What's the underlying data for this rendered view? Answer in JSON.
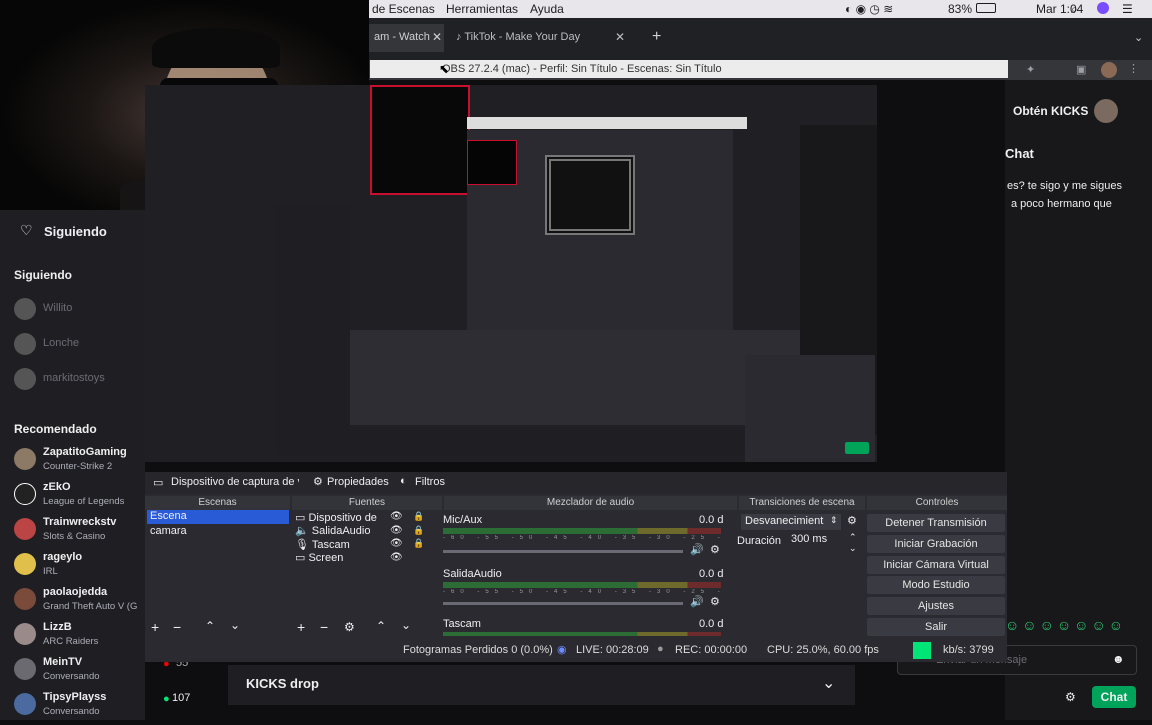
{
  "menubar": {
    "items": [
      "de Escenas",
      "Herramientas",
      "Ayuda"
    ],
    "battery": "83%",
    "time": "Mar 1:04"
  },
  "chrome": {
    "tabs": [
      {
        "label": "am - Watch"
      },
      {
        "label": "TikTok - Make Your Day"
      }
    ]
  },
  "obs_window": {
    "title": "OBS 27.2.4 (mac) - Perfil: Sin Título - Escenas: Sin Título"
  },
  "twitch": {
    "nav": {
      "following_heading": "Siguiendo",
      "following_label": "Siguiendo",
      "recommended_label": "Recomendado"
    },
    "following": [
      {
        "name": "Willito"
      },
      {
        "name": "Lonche"
      },
      {
        "name": "markitostoys"
      }
    ],
    "recommended": [
      {
        "name": "ZapatitoGaming",
        "game": "Counter-Strike 2"
      },
      {
        "name": "zEkO",
        "game": "League of Legends"
      },
      {
        "name": "Trainwreckstv",
        "game": "Slots & Casino"
      },
      {
        "name": "rageylo",
        "game": "IRL"
      },
      {
        "name": "paolaojedda",
        "game": "Grand Theft Auto V (G"
      },
      {
        "name": "LizzB",
        "game": "ARC Raiders"
      },
      {
        "name": "MeinTV",
        "game": "Conversando",
        "viewers": "55"
      },
      {
        "name": "TipsyPlayss",
        "game": "Conversando",
        "viewers": "107"
      }
    ],
    "right": {
      "kicks_button": "Obtén KICKS",
      "chat_heading": "Chat",
      "chat_line1": "es? te sigo y me sigues",
      "chat_line2": "a poco hermano que",
      "chat_input_placeholder": "Enviar un mensaje",
      "chat_button": "Chat"
    },
    "kicks_drop": "KICKS drop"
  },
  "obs": {
    "toolbar": {
      "source": "Dispositivo de captura de v",
      "properties": "Propiedades",
      "filters": "Filtros"
    },
    "docks": {
      "scenes": "Escenas",
      "sources": "Fuentes",
      "mixer": "Mezclador de audio",
      "transitions": "Transiciones de escena",
      "controls": "Controles"
    },
    "scenes": [
      "Escena",
      "camara"
    ],
    "sources": [
      "Dispositivo de",
      "SalidaAudio",
      "Tascam",
      "Screen"
    ],
    "mixer": [
      {
        "name": "Mic/Aux",
        "level": "0.0 d"
      },
      {
        "name": "SalidaAudio",
        "level": "0.0 d"
      },
      {
        "name": "Tascam",
        "level": "0.0 d"
      }
    ],
    "transitions": {
      "type": "Desvanecimient",
      "duration_label": "Duración",
      "duration": "300 ms"
    },
    "controls": [
      "Detener Transmisión",
      "Iniciar Grabación",
      "Iniciar Cámara Virtual",
      "Modo Estudio",
      "Ajustes",
      "Salir"
    ],
    "status": {
      "dropped": "Fotogramas Perdidos 0 (0.0%)",
      "live": "LIVE: 00:28:09",
      "rec": "REC: 00:00:00",
      "cpu": "CPU: 25.0%, 60.00 fps",
      "kbs": "kb/s: 3799"
    },
    "scale_ticks": "-60 -55 -50 -45 -40 -35 -30 -25 -20 -15 -10 -5 0"
  },
  "colors": {
    "obs_bg": "#2a2a30",
    "twitch_bg": "#1f1f23",
    "purple": "#9147ff",
    "live_green": "#00e676",
    "scene_selected": "#2a5bd7"
  }
}
